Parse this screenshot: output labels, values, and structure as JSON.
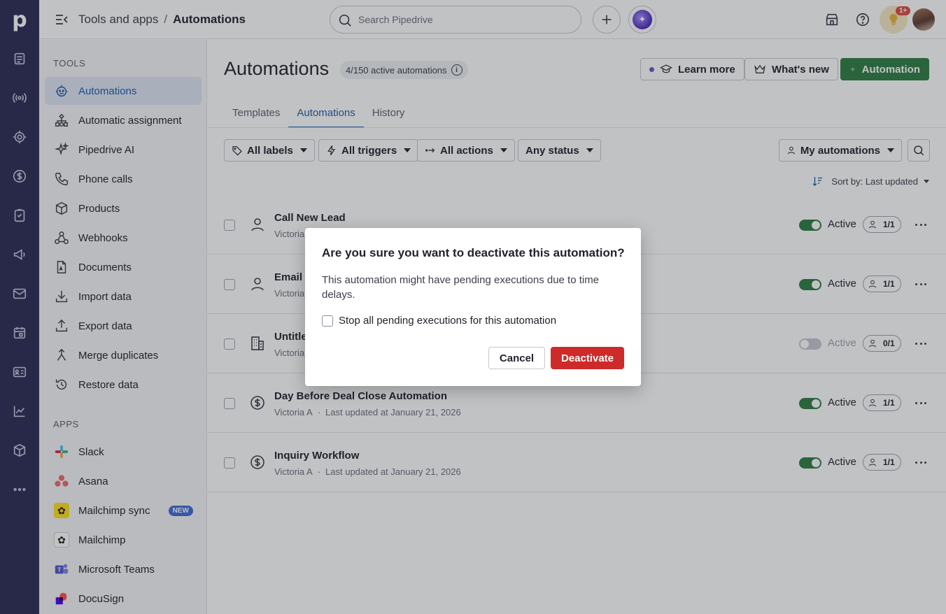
{
  "topbar": {
    "breadcrumb_parent": "Tools and apps",
    "breadcrumb_separator": "/",
    "breadcrumb_current": "Automations",
    "search_placeholder": "Search Pipedrive",
    "notification_badge": "1+"
  },
  "rail": {
    "logo": "p",
    "icons": [
      "leads-icon",
      "signal-icon",
      "target-icon",
      "deals-dollar-icon",
      "tasks-icon",
      "megaphone-icon",
      "mail-icon",
      "calendar-icon",
      "contacts-icon",
      "insights-chart-icon",
      "products-box-icon",
      "more-dots-icon"
    ]
  },
  "sidebar": {
    "tools_heading": "TOOLS",
    "tools": [
      {
        "label": "Automations",
        "icon": "automation-robot-icon",
        "active": true
      },
      {
        "label": "Automatic assignment",
        "icon": "assignment-tree-icon"
      },
      {
        "label": "Pipedrive AI",
        "icon": "sparkle-icon"
      },
      {
        "label": "Phone calls",
        "icon": "phone-icon"
      },
      {
        "label": "Products",
        "icon": "box-icon"
      },
      {
        "label": "Webhooks",
        "icon": "webhook-icon"
      },
      {
        "label": "Documents",
        "icon": "document-icon"
      },
      {
        "label": "Import data",
        "icon": "import-icon"
      },
      {
        "label": "Export data",
        "icon": "export-icon"
      },
      {
        "label": "Merge duplicates",
        "icon": "merge-icon"
      },
      {
        "label": "Restore data",
        "icon": "restore-icon"
      }
    ],
    "apps_heading": "APPS",
    "apps": [
      {
        "label": "Slack",
        "icon": "slack-logo-icon"
      },
      {
        "label": "Asana",
        "icon": "asana-logo-icon"
      },
      {
        "label": "Mailchimp sync",
        "icon": "mailchimp-sync-logo-icon",
        "badge": "NEW"
      },
      {
        "label": "Mailchimp",
        "icon": "mailchimp-logo-icon"
      },
      {
        "label": "Microsoft Teams",
        "icon": "teams-logo-icon"
      },
      {
        "label": "DocuSign",
        "icon": "docusign-logo-icon"
      }
    ]
  },
  "main": {
    "title": "Automations",
    "active_count": "4/150 active automations",
    "learn_more": "Learn more",
    "whats_new": "What's new",
    "add_automation": "Automation",
    "tabs": [
      "Templates",
      "Automations",
      "History"
    ],
    "active_tab": "Automations",
    "filters": {
      "labels": "All labels",
      "triggers": "All triggers",
      "actions": "All actions",
      "status": "Any status",
      "owner": "My automations"
    },
    "sort_label": "Sort by: Last updated",
    "rows": [
      {
        "name": "Call New Lead",
        "owner": "Victoria",
        "updated": "",
        "status": "Active",
        "active": true,
        "owners": "1/1",
        "icon": "person-icon"
      },
      {
        "name": "Email S",
        "owner": "Victoria",
        "updated": "",
        "status": "Active",
        "active": true,
        "owners": "1/1",
        "icon": "person-icon"
      },
      {
        "name": "Untitle",
        "owner": "Victoria",
        "updated": "",
        "status": "Active",
        "active": false,
        "owners": "0/1",
        "icon": "building-icon"
      },
      {
        "name": "Day Before Deal Close Automation",
        "owner": "Victoria A",
        "updated": "Last updated at January 21, 2026",
        "status": "Active",
        "active": true,
        "owners": "1/1",
        "icon": "dollar-circle-icon"
      },
      {
        "name": "Inquiry Workflow",
        "owner": "Victoria A",
        "updated": "Last updated at January 21, 2026",
        "status": "Active",
        "active": true,
        "owners": "1/1",
        "icon": "dollar-circle-icon"
      }
    ],
    "meta_separator": "·"
  },
  "dialog": {
    "title": "Are you sure you want to deactivate this automation?",
    "body": "This automation might have pending executions due to time delays.",
    "checkbox_label": "Stop all pending executions for this automation",
    "cancel": "Cancel",
    "confirm": "Deactivate"
  },
  "colors": {
    "rail": "#2c2a54",
    "primary_green": "#2e7d43",
    "active_blue": "#1e5fa8",
    "danger_red": "#cf2a2a"
  }
}
